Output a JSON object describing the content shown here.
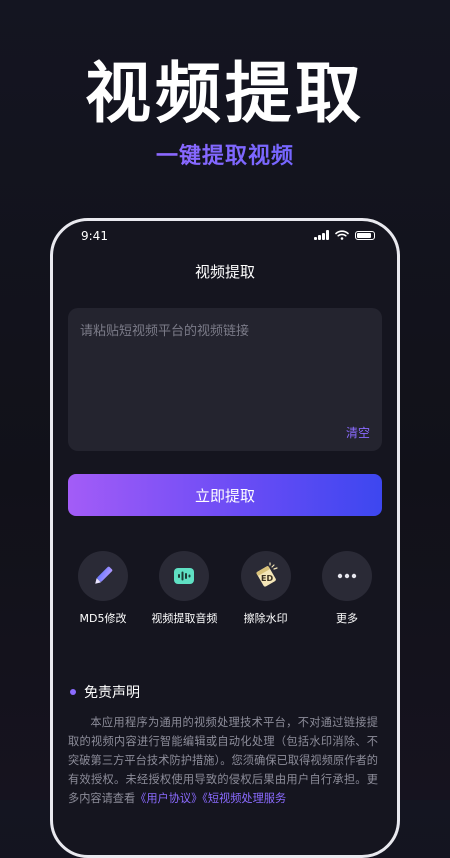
{
  "promo": {
    "title": "视频提取",
    "subtitle": "一键提取视频"
  },
  "status_bar": {
    "time": "9:41"
  },
  "app": {
    "title": "视频提取",
    "input_placeholder": "请粘贴短视频平台的视频链接",
    "input_value": "",
    "clear_label": "清空",
    "extract_label": "立即提取"
  },
  "tools": [
    {
      "label": "MD5修改",
      "icon": "pencil-icon"
    },
    {
      "label": "视频提取音频",
      "icon": "audio-wave-icon"
    },
    {
      "label": "擦除水印",
      "icon": "eraser-watermark-icon"
    },
    {
      "label": "更多",
      "icon": "more-dots-icon"
    }
  ],
  "disclaimer": {
    "title": "免责声明",
    "body_text": "本应用程序为通用的视频处理技术平台，不对通过链接提取的视频内容进行智能编辑或自动化处理（包括水印消除、不突破第三方平台技术防护措施）。您须确保已取得视频原作者的有效授权。未经授权使用导致的侵权后果由用户自行承担。更多内容请查看",
    "link_user_agreement": "《用户协议》",
    "link_service": "《短视频处理服务"
  },
  "colors": {
    "accent": "#8b6bff",
    "button_gradient_start": "#a35cf7",
    "button_gradient_end": "#3d47f0",
    "background": "#15151f",
    "panel": "#24242f"
  }
}
